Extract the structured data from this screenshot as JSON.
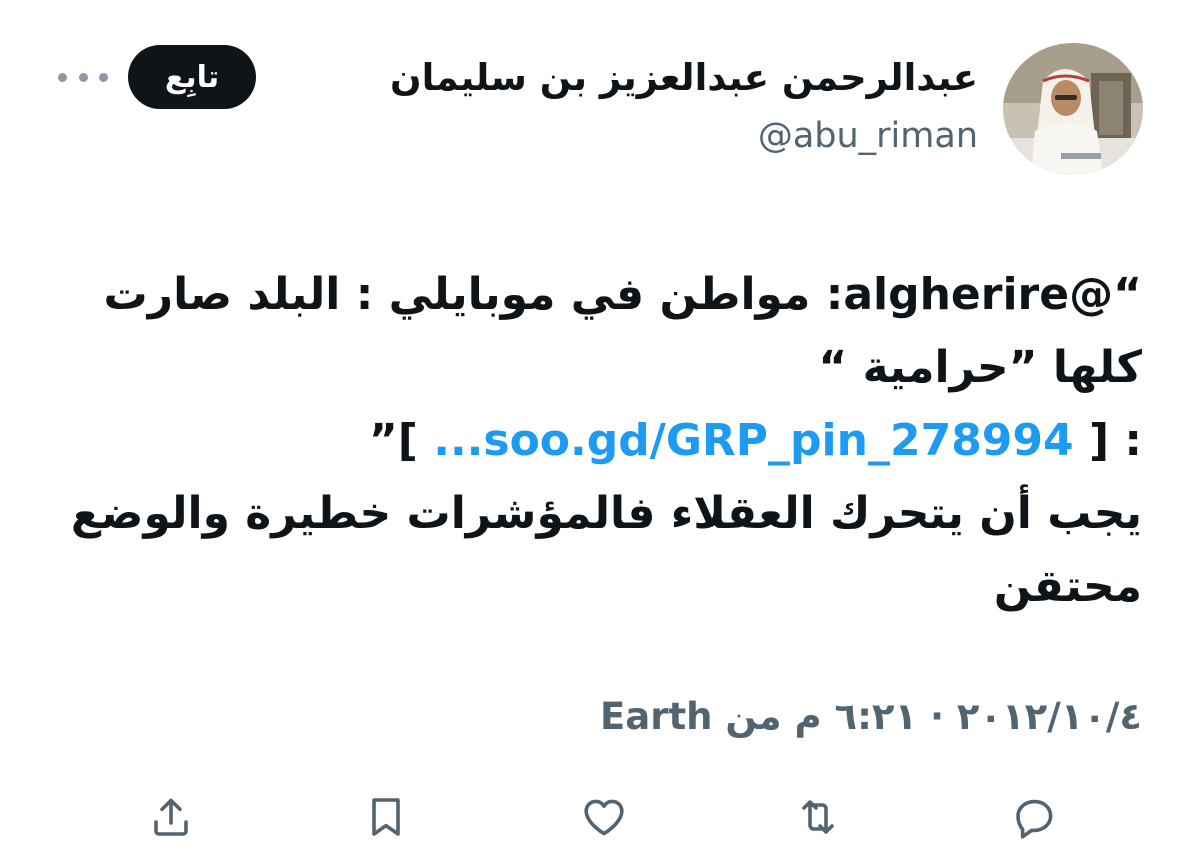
{
  "author": {
    "display_name": "عبدالرحمن عبدالعزيز بن سليمان",
    "handle": "@abu_riman"
  },
  "follow_button": {
    "label": "تابِع"
  },
  "tweet": {
    "lines": [
      "“@algherire: مواطن في موبايلي : البلد صارت",
      "كلها ”حرامية “",
      "",
      "يجب أن يتحرك العقلاء فالمؤشرات خطيرة والوضع",
      "محتقن"
    ],
    "link_line": {
      "prefix": ": [ ",
      "link_text": "soo.gd/GRP_pin_278994...",
      "suffix": " ]”"
    }
  },
  "meta": {
    "date": "٢٠١٢/١٠/٤",
    "separator": "·",
    "time": "٦:٢١ م",
    "source_prefix": "من",
    "source": "Earth"
  },
  "actions": [
    {
      "name": "reply",
      "icon": "reply-icon"
    },
    {
      "name": "retweet",
      "icon": "retweet-icon"
    },
    {
      "name": "like",
      "icon": "heart-icon"
    },
    {
      "name": "bookmark",
      "icon": "bookmark-icon"
    },
    {
      "name": "share",
      "icon": "share-icon"
    }
  ],
  "colors": {
    "text": "#0f1419",
    "secondary": "#536471",
    "link": "#1d9bf0",
    "button_bg": "#0f1419"
  }
}
